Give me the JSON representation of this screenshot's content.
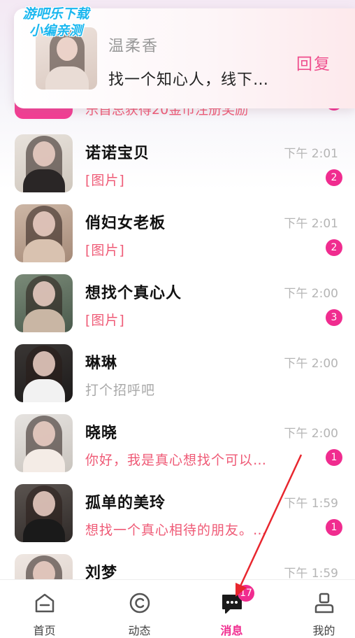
{
  "watermark": {
    "line1": "游吧乐下载",
    "line2": "小编亲测"
  },
  "notification": {
    "name": "温柔香",
    "message": "找一个知心人，线下…",
    "reply_label": "回复"
  },
  "peek_row": {
    "preview": "乐首总获得20金币注册奖励"
  },
  "conversations": [
    {
      "name": "诺诺宝贝",
      "time": "下午 2:01",
      "preview": "[图片]",
      "badge": "2",
      "preview_style": "pink"
    },
    {
      "name": "俏妇女老板",
      "time": "下午 2:01",
      "preview": "[图片]",
      "badge": "2",
      "preview_style": "pink"
    },
    {
      "name": "想找个真心人",
      "time": "下午 2:00",
      "preview": "[图片]",
      "badge": "3",
      "preview_style": "pink"
    },
    {
      "name": "琳琳",
      "time": "下午 2:00",
      "preview": "打个招呼吧",
      "badge": "",
      "preview_style": "gray"
    },
    {
      "name": "晓晓",
      "time": "下午 2:00",
      "preview": "你好，我是真心想找个可以…",
      "badge": "1",
      "preview_style": "pink"
    },
    {
      "name": "孤单的美玲",
      "time": "下午 1:59",
      "preview": "想找一个真心相待的朋友。…",
      "badge": "1",
      "preview_style": "pink"
    },
    {
      "name": "刘梦",
      "time": "下午 1:59",
      "preview": "",
      "badge": "",
      "preview_style": "pink"
    }
  ],
  "tabbar": {
    "tabs": [
      {
        "label": "首页",
        "icon": "home-icon"
      },
      {
        "label": "动态",
        "icon": "moments-icon"
      },
      {
        "label": "消息",
        "icon": "message-icon"
      },
      {
        "label": "我的",
        "icon": "profile-icon"
      }
    ],
    "active": "消息",
    "message_badge": "17"
  },
  "colors": {
    "accent": "#f02c8f",
    "preview_pink": "#ef5a76",
    "time_gray": "#b5b5b5"
  }
}
